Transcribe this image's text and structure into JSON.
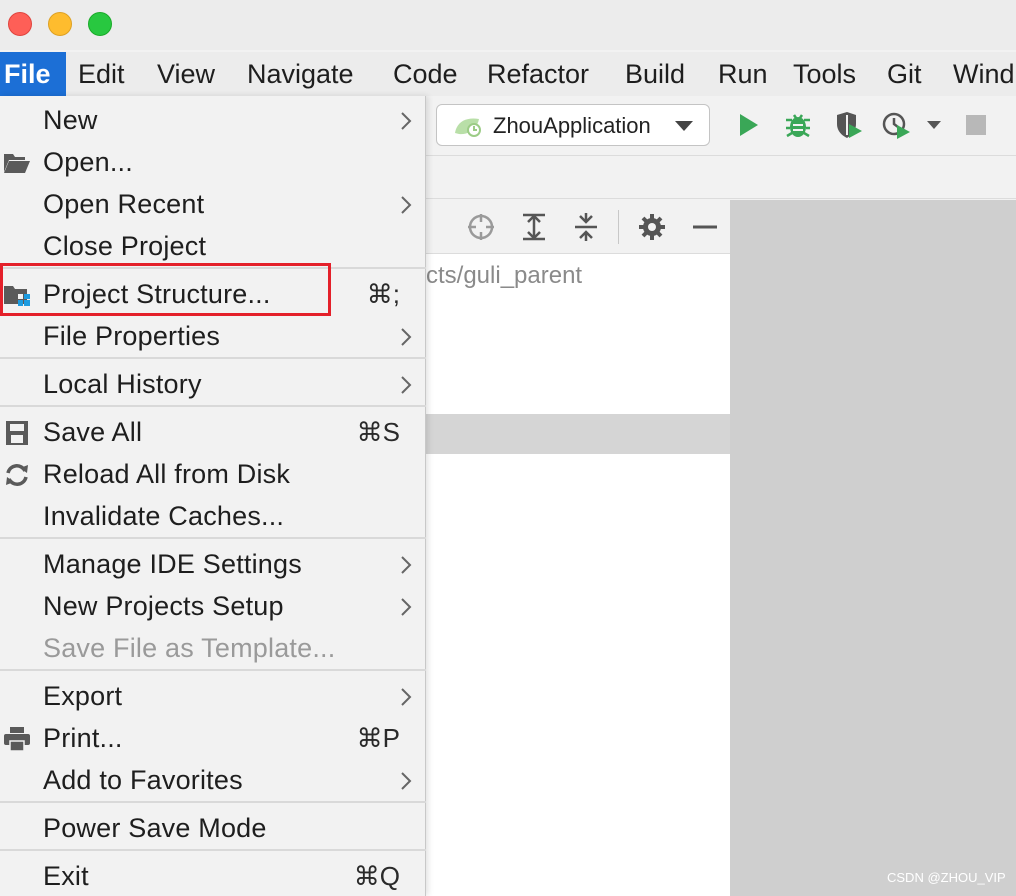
{
  "menubar": {
    "items": [
      "File",
      "Edit",
      "View",
      "Navigate",
      "Code",
      "Refactor",
      "Build",
      "Run",
      "Tools",
      "Git",
      "Wind"
    ],
    "active": "File"
  },
  "toolbar": {
    "run_config": "ZhouApplication",
    "icons": [
      "spring-leaf-icon",
      "run-icon",
      "debug-icon",
      "coverage-icon",
      "profile-icon",
      "stop-icon"
    ]
  },
  "project_panel": {
    "path_fragment": "cts/guli_parent",
    "icons": [
      "locate-icon",
      "expand-all-icon",
      "collapse-all-icon",
      "gear-icon",
      "hide-icon"
    ]
  },
  "file_menu": {
    "items": [
      {
        "label": "New",
        "submenu": true
      },
      {
        "label": "Open...",
        "icon": "folder-open-icon"
      },
      {
        "label": "Open Recent",
        "submenu": true
      },
      {
        "label": "Close Project"
      },
      {
        "label": "Project Structure...",
        "shortcut": "⌘;",
        "icon": "project-structure-icon",
        "highlighted": true
      },
      {
        "label": "File Properties",
        "submenu": true
      },
      {
        "label": "Local History",
        "submenu": true
      },
      {
        "label": "Save All",
        "shortcut": "⌘S",
        "icon": "save-icon"
      },
      {
        "label": "Reload All from Disk",
        "icon": "reload-icon"
      },
      {
        "label": "Invalidate Caches..."
      },
      {
        "label": "Manage IDE Settings",
        "submenu": true
      },
      {
        "label": "New Projects Setup",
        "submenu": true
      },
      {
        "label": "Save File as Template...",
        "disabled": true
      },
      {
        "label": "Export",
        "submenu": true
      },
      {
        "label": "Print...",
        "shortcut": "⌘P",
        "icon": "print-icon"
      },
      {
        "label": "Add to Favorites",
        "submenu": true
      },
      {
        "label": "Power Save Mode"
      },
      {
        "label": "Exit",
        "shortcut": "⌘Q"
      }
    ]
  },
  "watermark": "CSDN @ZHOU_VIP",
  "colors": {
    "accent": "#1c6fd6",
    "highlight": "#e4202a",
    "run": "#3aa757"
  }
}
